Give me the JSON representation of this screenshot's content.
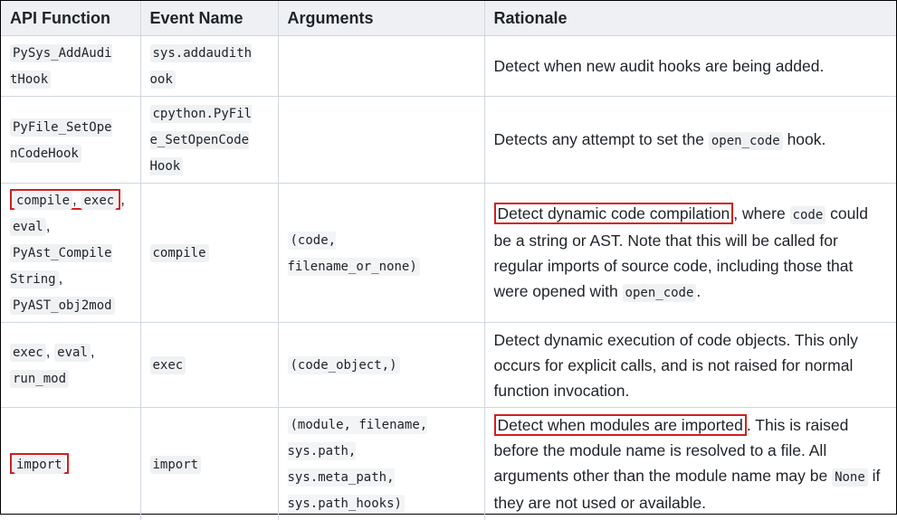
{
  "headers": [
    "API Function",
    "Event Name",
    "Arguments",
    "Rationale"
  ],
  "rows": [
    {
      "func": [
        "PySys_AddAudi\ntHook"
      ],
      "event": "sys.addaudith\nook",
      "args": "",
      "rationale": {
        "pre": "",
        "hl": "",
        "text": "Detect when new audit hooks are being added."
      }
    },
    {
      "func": [
        "PyFile_SetOpe\nnCodeHook"
      ],
      "event": "cpython.PyFil\ne_SetOpenCode\nHook",
      "args": "",
      "rationale": {
        "a": "Detects any attempt to set the ",
        "code": "open_code",
        "b": " hook."
      }
    },
    {
      "func": [
        "compile",
        "exec",
        "eval",
        "PyAst_Compile\nString",
        "PyAST_obj2mod"
      ],
      "event": "compile",
      "args": "(code,\nfilename_or_none)",
      "rationale": {
        "hl": "Detect dynamic code compilation",
        "a": ", where ",
        "code1": "code",
        "b": " could be a string or AST. Note that this will be called for regular imports of source code, including those that were opened with ",
        "code2": "open_code",
        "c": "."
      }
    },
    {
      "func": [
        "exec",
        "eval",
        "run_mod"
      ],
      "event": "exec",
      "args": "(code_object,)",
      "rationale": {
        "text": "Detect dynamic execution of code objects. This only occurs for explicit calls, and is not raised for normal function invocation."
      }
    },
    {
      "func": [
        "import"
      ],
      "event": "import",
      "args": "(module, filename,\nsys.path,\nsys.meta_path,\nsys.path_hooks)",
      "rationale": {
        "hl": "Detect when modules are imported",
        "a": ". This is raised before the module name is resolved to a file. All arguments other than the module name may be ",
        "code": "None",
        "b": " if they are not used or available."
      }
    }
  ]
}
